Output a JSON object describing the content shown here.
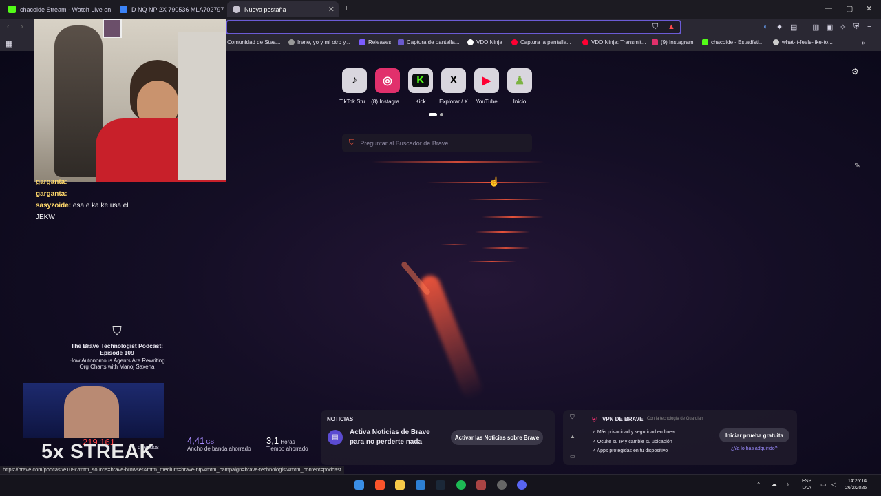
{
  "tabs": [
    {
      "label": "chacoide Stream - Watch Live on",
      "color": "#53fc18",
      "active": false
    },
    {
      "label": "D NQ NP 2X 790536 MLA702797637",
      "color": "#3b82f6",
      "active": false
    },
    {
      "label": "Nueva pestaña",
      "color": "#c7c3d0",
      "active": true
    }
  ],
  "window": {
    "minimize": "—",
    "maximize": "▢",
    "close": "✕",
    "new_tab": "+"
  },
  "bookmarks": [
    {
      "label": "Comunidad de Stea...",
      "color": "#1b2838"
    },
    {
      "label": "Irene, yo y mi otro y...",
      "color": "#999999"
    },
    {
      "label": "Releases",
      "color": "#7b5cff"
    },
    {
      "label": "Captura de pantalla...",
      "color": "#6a5acd"
    },
    {
      "label": "VDO.Ninja",
      "color": "#ffffff"
    },
    {
      "label": "Captura la pantalla...",
      "color": "#ff0033"
    },
    {
      "label": "VDO.Ninja: Transmit...",
      "color": "#ff0033"
    },
    {
      "label": "(9) Instagram",
      "color": "#e1306c"
    },
    {
      "label": "chacoide - Estadísti...",
      "color": "#53fc18"
    },
    {
      "label": "what-it-feels-like-to...",
      "color": "#cccccc"
    }
  ],
  "shortcuts": [
    {
      "label": "TikTok Stu...",
      "glyph": "♪",
      "color": "#000000",
      "bg": "#ffffff"
    },
    {
      "label": "(8) Instagra...",
      "glyph": "◎",
      "color": "#ffffff",
      "bg": "#e1306c"
    },
    {
      "label": "Kick",
      "glyph": "K",
      "color": "#53fc18",
      "bg": "#0b0e0f"
    },
    {
      "label": "Explorar / X",
      "glyph": "X",
      "color": "#000000",
      "bg": "#ffffff"
    },
    {
      "label": "YouTube",
      "glyph": "▶",
      "color": "#ffffff",
      "bg": "#ff0033"
    },
    {
      "label": "Inicio",
      "glyph": "♟",
      "color": "#7cb342",
      "bg": "#d9d6de"
    }
  ],
  "search": {
    "placeholder": "Preguntar al Buscador de Brave"
  },
  "chat": [
    {
      "user": "garganta:",
      "text": ""
    },
    {
      "user": "garganta:",
      "text": ""
    },
    {
      "user": "sasyzoide:",
      "text": " esa e ka ke usa el"
    },
    {
      "user": "",
      "text": "JEKW"
    }
  ],
  "podcast": {
    "title": "The Brave Technologist Podcast: Episode 109",
    "subtitle": "How Autonomous Agents Are Rewriting Org Charts with Manoj Saxena"
  },
  "streak": {
    "text": "5x STREAK"
  },
  "stats": [
    {
      "value": "219.161",
      "unit": "",
      "label": "queados"
    },
    {
      "value": "4,41",
      "unit": "GB",
      "label": "Ancho de banda ahorrado"
    },
    {
      "value": "3,1",
      "unit": "Horas",
      "label": "Tiempo ahorrado"
    }
  ],
  "news": {
    "heading": "NOTICIAS",
    "text": "Activa Noticias de Brave para no perderte nada",
    "button": "Activar las Noticias sobre Brave"
  },
  "vpn": {
    "heading": "VPN DE BRAVE",
    "powered": "Con la tecnología de",
    "provider": "Guardian",
    "features": [
      "Más privacidad y seguridad en línea",
      "Oculte su IP y cambie su ubicación",
      "Apps protegidas en tu dispositivo"
    ],
    "button": "Iniciar prueba gratuita",
    "link": "¿Ya lo has adquirido?"
  },
  "statusbar": {
    "url": "https://brave.com/podcast/e109/?mtm_source=brave-browser&mtm_medium=brave-ntp&mtm_campaign=brave-technologist&mtm_content=podcast"
  },
  "taskbar": {
    "lang": "ESP",
    "region": "LAA",
    "time": "14:26:14",
    "date": "26/2/2026"
  }
}
